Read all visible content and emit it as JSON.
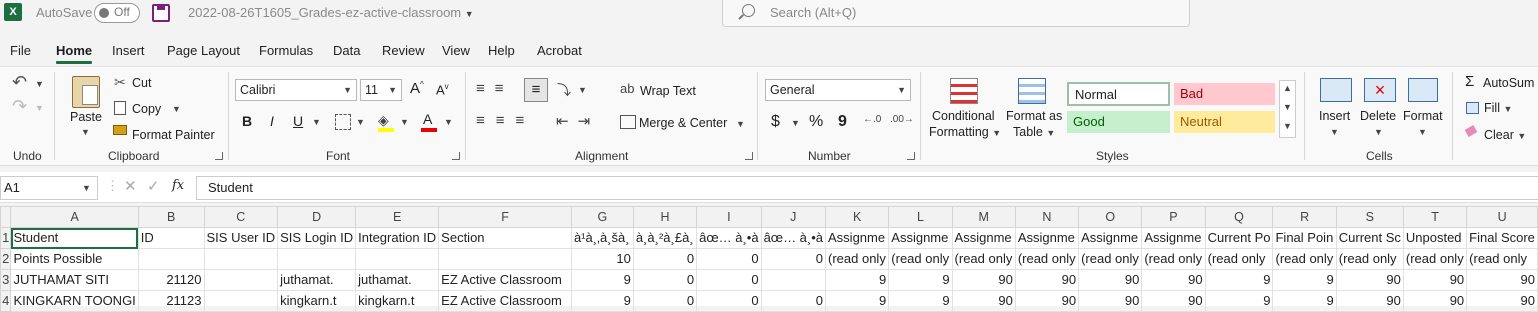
{
  "titlebar": {
    "app_icon": "X",
    "autosave_label": "AutoSave",
    "toggle_state": "Off",
    "filename": "2022-08-26T1605_Grades-ez-active-classroom",
    "search_placeholder": "Search (Alt+Q)"
  },
  "tabs": [
    "File",
    "Home",
    "Insert",
    "Page Layout",
    "Formulas",
    "Data",
    "Review",
    "View",
    "Help",
    "Acrobat"
  ],
  "active_tab": "Home",
  "ribbon": {
    "undo": {
      "label": "Undo"
    },
    "clipboard": {
      "paste": "Paste",
      "cut": "Cut",
      "copy": "Copy",
      "format_painter": "Format Painter",
      "label": "Clipboard"
    },
    "font": {
      "name": "Calibri",
      "size": "11",
      "bold": "B",
      "italic": "I",
      "underline": "U",
      "label": "Font",
      "grow": "A",
      "shrink": "A"
    },
    "alignment": {
      "wrap_text": "Wrap Text",
      "merge_center": "Merge & Center",
      "label": "Alignment"
    },
    "number": {
      "format": "General",
      "currency": "$",
      "percent": "%",
      "comma": "9",
      "label": "Number"
    },
    "styles": {
      "conditional": "Conditional",
      "conditional2": "Formatting",
      "format_as": "Format as",
      "format_as2": "Table",
      "normal": "Normal",
      "bad": "Bad",
      "good": "Good",
      "neutral": "Neutral",
      "label": "Styles"
    },
    "cells": {
      "insert": "Insert",
      "delete": "Delete",
      "format": "Format",
      "label": "Cells"
    },
    "editing": {
      "autosum": "AutoSum",
      "fill": "Fill",
      "clear": "Clear"
    }
  },
  "formula_bar": {
    "cell_ref": "A1",
    "fx": "fx",
    "value": "Student"
  },
  "colors": {
    "accent": "#1d6f42",
    "bad_bg": "#ffc7ce",
    "bad_fg": "#9c0006",
    "good_bg": "#c6efce",
    "good_fg": "#006100",
    "neutral_bg": "#ffeb9c",
    "neutral_fg": "#9c5700"
  },
  "sheet": {
    "columns": [
      "A",
      "B",
      "C",
      "D",
      "E",
      "F",
      "G",
      "H",
      "I",
      "J",
      "K",
      "L",
      "M",
      "N",
      "O",
      "P",
      "Q",
      "R",
      "S",
      "T",
      "U"
    ],
    "rows": [
      {
        "num": "1",
        "cells": [
          "Student",
          "ID",
          "SIS User ID",
          "SIS Login ID",
          "Integration ID",
          "Section",
          "à¹à¸‚à¸šà¸",
          "à¸à¸²à¸£à¸",
          "âœ… à¸•à",
          "âœ… à¸•à",
          "Assignme",
          "Assignme",
          "Assignme",
          "Assignme",
          "Assignme",
          "Assignme",
          "Current Po",
          "Final Poin",
          "Current Sc",
          "Unposted",
          "Final Score"
        ]
      },
      {
        "num": "2",
        "cells": [
          "    Points Possible",
          "",
          "",
          "",
          "",
          "",
          "10",
          "0",
          "0",
          "0",
          "(read only",
          "(read only",
          "(read only",
          "(read only",
          "(read only",
          "(read only",
          "(read only",
          "(read only",
          "(read only",
          "(read only",
          "(read only"
        ]
      },
      {
        "num": "3",
        "cells": [
          "JUTHAMAT SITI",
          "21120",
          "",
          "juthamat.",
          "juthamat.",
          "EZ Active Classroom",
          "9",
          "0",
          "0",
          "",
          "9",
          "9",
          "90",
          "90",
          "90",
          "90",
          "9",
          "9",
          "90",
          "90",
          "90"
        ]
      },
      {
        "num": "4",
        "cells": [
          "KINGKARN TOONGI",
          "21123",
          "",
          "kingkarn.t",
          "kingkarn.t",
          "EZ Active Classroom",
          "9",
          "0",
          "0",
          "0",
          "9",
          "9",
          "90",
          "90",
          "90",
          "90",
          "9",
          "9",
          "90",
          "90",
          "90"
        ]
      }
    ]
  }
}
